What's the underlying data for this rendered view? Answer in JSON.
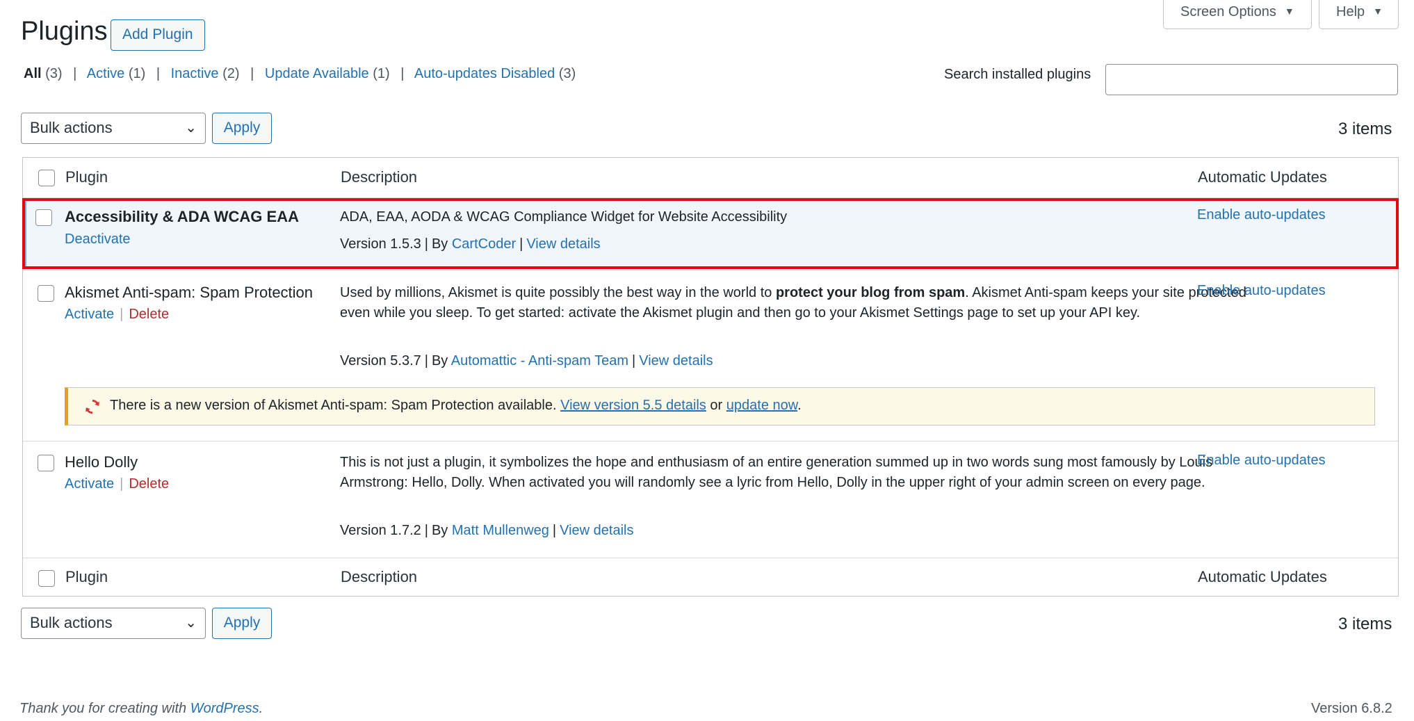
{
  "header": {
    "title": "Plugins",
    "add_button": "Add Plugin",
    "screen_options": "Screen Options",
    "help": "Help"
  },
  "filters": [
    {
      "label": "All",
      "count": "(3)"
    },
    {
      "label": "Active",
      "count": "(1)"
    },
    {
      "label": "Inactive",
      "count": "(2)"
    },
    {
      "label": "Update Available",
      "count": "(1)"
    },
    {
      "label": "Auto-updates Disabled",
      "count": "(3)"
    }
  ],
  "search": {
    "label": "Search installed plugins",
    "value": ""
  },
  "tablenav": {
    "bulk_actions": "Bulk actions",
    "apply": "Apply",
    "items": "3 items"
  },
  "columns": {
    "plugin": "Plugin",
    "description": "Description",
    "auto_updates": "Automatic Updates"
  },
  "plugins": [
    {
      "name": "Accessibility & ADA WCAG EAA",
      "action1": "Deactivate",
      "description": "ADA, EAA, AODA & WCAG Compliance Widget for Website Accessibility",
      "version": "Version 1.5.3",
      "by": "By",
      "author": "CartCoder",
      "view_details": "View details",
      "auto_update": "Enable auto-updates"
    },
    {
      "name": "Akismet Anti-spam: Spam Protection",
      "action1": "Activate",
      "action2": "Delete",
      "description_pre": "Used by millions, Akismet is quite possibly the best way in the world to",
      "description_bold": "protect your blog from spam",
      "description_post": ". Akismet Anti-spam keeps your site protected even while you sleep. To get started: activate the Akismet plugin and then go to your Akismet Settings page to set up your API key.",
      "version": "Version 5.3.7",
      "by": "By",
      "author": "Automattic - Anti-spam Team",
      "view_details": "View details",
      "auto_update": "Enable auto-updates",
      "notice": {
        "text": "There is a new version of Akismet Anti-spam: Spam Protection available.",
        "link1": "View version 5.5 details",
        "or": "or",
        "link2": "update now",
        "end": "."
      }
    },
    {
      "name": "Hello Dolly",
      "action1": "Activate",
      "action2": "Delete",
      "description": "This is not just a plugin, it symbolizes the hope and enthusiasm of an entire generation summed up in two words sung most famously by Louis Armstrong: Hello, Dolly. When activated you will randomly see a lyric from Hello, Dolly in the upper right of your admin screen on every page.",
      "version": "Version 1.7.2",
      "by": "By",
      "author": "Matt Mullenweg",
      "view_details": "View details",
      "auto_update": "Enable auto-updates"
    }
  ],
  "footer": {
    "thanks": "Thank you for creating with",
    "wp_link": "WordPress",
    "thanks_end": ".",
    "version": "Version 6.8.2"
  },
  "colors": {
    "link": "#2271b1",
    "delete": "#b32d2e",
    "highlight": "#e00a14",
    "notice_border": "#dba617"
  }
}
